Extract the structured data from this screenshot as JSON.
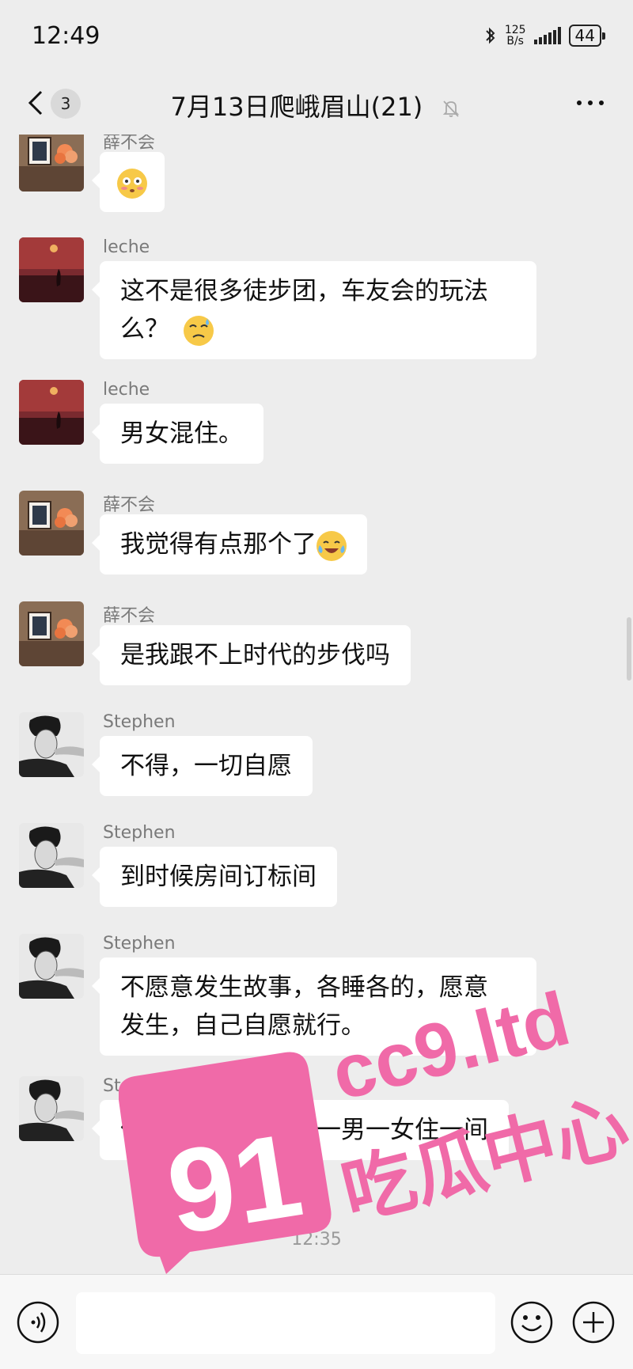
{
  "status_bar": {
    "time": "12:49",
    "speed_value": "125",
    "speed_unit": "B/s",
    "battery": "44"
  },
  "header": {
    "unread_count": "3",
    "title": "7月13日爬峨眉山(21)"
  },
  "messages": [
    {
      "sender": "薛不会",
      "text": "",
      "emoji": "flushed-face",
      "avatar": "photo-frame-flowers"
    },
    {
      "sender": "leche",
      "text_line1": "这不是很多徒步团，车友会的玩法",
      "text_line2": "么？",
      "emoji": "dizzy-sweat-face",
      "avatar": "sunset-silhouette"
    },
    {
      "sender": "leche",
      "text": "男女混住。",
      "avatar": "sunset-silhouette"
    },
    {
      "sender": "薛不会",
      "text": "我觉得有点那个了",
      "emoji": "tears-of-joy-face",
      "avatar": "photo-frame-flowers"
    },
    {
      "sender": "薛不会",
      "text": "是我跟不上时代的步伐吗",
      "avatar": "photo-frame-flowers"
    },
    {
      "sender": "Stephen",
      "text": "不得，一切自愿",
      "avatar": "bw-portrait"
    },
    {
      "sender": "Stephen",
      "text": "到时候房间订标间",
      "avatar": "bw-portrait"
    },
    {
      "sender": "Stephen",
      "text_line1": "不愿意发生故事，各睡各的，愿意",
      "text_line2": "发生，自己自愿就行。",
      "avatar": "bw-portrait"
    },
    {
      "sender": "Stephen",
      "text": "但是一定要抽签，一男一女住一间",
      "avatar": "bw-portrait"
    }
  ],
  "timestamp": "12:35",
  "watermark": {
    "number": "91",
    "domain": "cc9.ltd",
    "tagline": "吃瓜中心",
    "color": "#f06aa8"
  },
  "input_bar": {
    "placeholder": ""
  },
  "icons": [
    "back-arrow-icon",
    "mute-bell-icon",
    "more-dots-icon",
    "voice-icon",
    "emoji-icon",
    "plus-icon"
  ]
}
